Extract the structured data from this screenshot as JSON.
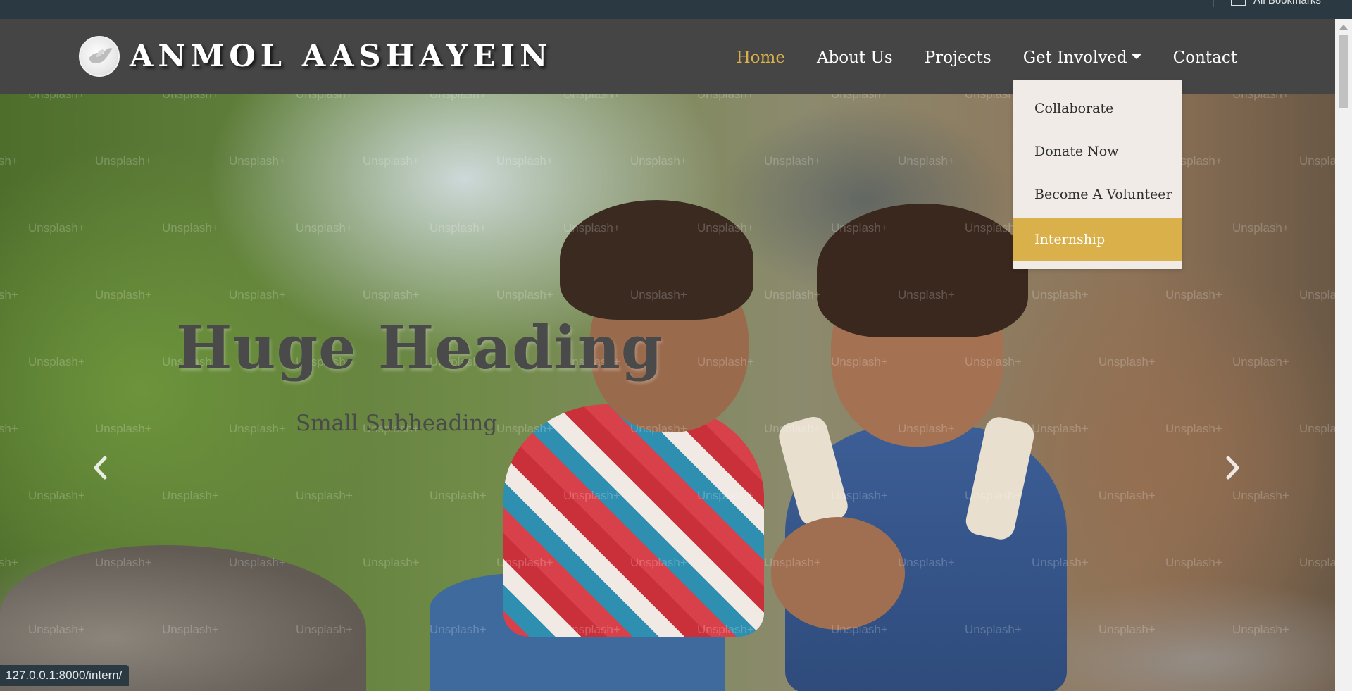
{
  "browser": {
    "bookmarks_label": "All Bookmarks",
    "status_url": "127.0.0.1:8000/intern/"
  },
  "navbar": {
    "brand": "ANMOL AASHAYEIN",
    "links": [
      {
        "label": "Home",
        "active": true
      },
      {
        "label": "About Us",
        "active": false
      },
      {
        "label": "Projects",
        "active": false
      },
      {
        "label": "Get Involved",
        "active": false,
        "has_dropdown": true
      },
      {
        "label": "Contact",
        "active": false
      }
    ],
    "accent_color": "#d9b04a"
  },
  "dropdown": {
    "items": [
      {
        "label": "Collaborate",
        "highlighted": false
      },
      {
        "label": "Donate Now",
        "highlighted": false
      },
      {
        "label": "Become A Volunteer",
        "highlighted": false
      },
      {
        "label": "Internship",
        "highlighted": true
      }
    ]
  },
  "hero": {
    "heading": "Huge Heading",
    "subheading": "Small Subheading",
    "watermark": "Unsplash+",
    "prev_icon": "chevron-left-icon",
    "next_icon": "chevron-right-icon"
  }
}
